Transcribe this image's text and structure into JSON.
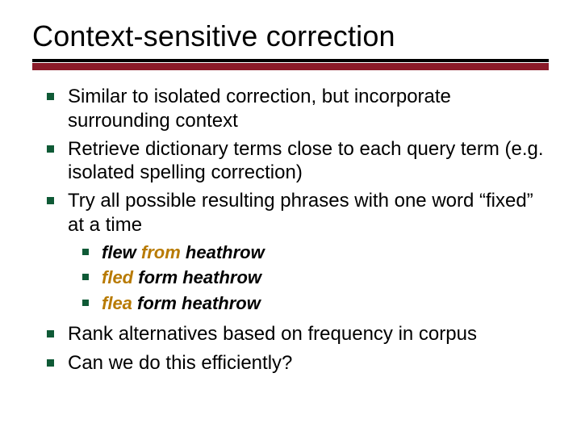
{
  "title": "Context-sensitive correction",
  "bullets": {
    "b1": "Similar to isolated correction, but incorporate surrounding context",
    "b2": "Retrieve dictionary terms close to each query term (e.g. isolated spelling correction)",
    "b3": "Try all possible resulting phrases with one word “fixed” at a time",
    "b4": "Rank alternatives based on frequency in corpus",
    "b5": "Can we do this efficiently?"
  },
  "examples": {
    "e1_pre": "flew ",
    "e1_hl": "from",
    "e1_post": " heathrow",
    "e2_hl": "fled",
    "e2_post": " form heathrow",
    "e3_hl": "flea",
    "e3_post": " form heathrow"
  }
}
